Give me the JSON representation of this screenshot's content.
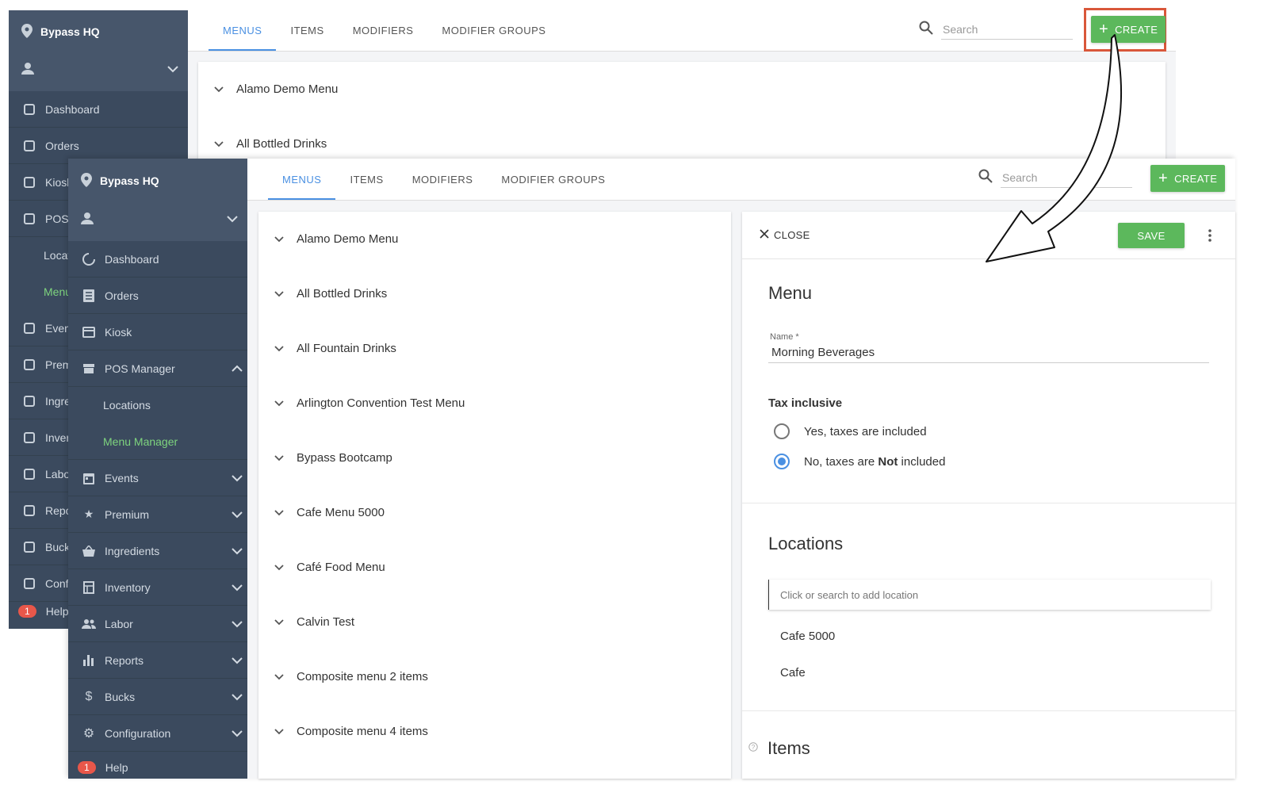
{
  "back": {
    "brand": "Bypass HQ",
    "tabs": [
      "MENUS",
      "ITEMS",
      "MODIFIERS",
      "MODIFIER GROUPS"
    ],
    "search_placeholder": "Search",
    "create_label": "CREATE",
    "menus": [
      "Alamo Demo Menu",
      "All Bottled Drinks"
    ],
    "sidebar": [
      {
        "label": "Dashboard",
        "icon": "dashboard-icon"
      },
      {
        "label": "Orders",
        "icon": "orders-icon"
      },
      {
        "label": "Kiosk",
        "icon": "kiosk-icon"
      },
      {
        "label": "POS M",
        "icon": "store-icon"
      },
      {
        "label": "Locat",
        "icon": ""
      },
      {
        "label": "Menu",
        "icon": ""
      },
      {
        "label": "Event",
        "icon": "calendar-icon"
      },
      {
        "label": "Premi",
        "icon": "star-icon"
      },
      {
        "label": "Ingre",
        "icon": "basket-icon"
      },
      {
        "label": "Inven",
        "icon": "inventory-icon"
      },
      {
        "label": "Labor",
        "icon": "people-icon"
      },
      {
        "label": "Repor",
        "icon": "bar-chart-icon"
      },
      {
        "label": "Bucks",
        "icon": "dollar-icon"
      },
      {
        "label": "Confi",
        "icon": "gear-icon"
      }
    ],
    "help": {
      "count": "1",
      "label": "Help"
    }
  },
  "front": {
    "brand": "Bypass HQ",
    "tabs": [
      "MENUS",
      "ITEMS",
      "MODIFIERS",
      "MODIFIER GROUPS"
    ],
    "search_placeholder": "Search",
    "create_label": "CREATE",
    "sidebar": {
      "dashboard": "Dashboard",
      "orders": "Orders",
      "kiosk": "Kiosk",
      "pos_manager": "POS Manager",
      "locations": "Locations",
      "menu_manager": "Menu Manager",
      "events": "Events",
      "premium": "Premium",
      "ingredients": "Ingredients",
      "inventory": "Inventory",
      "labor": "Labor",
      "reports": "Reports",
      "bucks": "Bucks",
      "configuration": "Configuration",
      "help": "Help",
      "help_count": "1"
    },
    "menus": [
      "Alamo Demo Menu",
      "All Bottled Drinks",
      "All Fountain Drinks",
      "Arlington Convention Test Menu",
      "Bypass Bootcamp",
      "Cafe Menu 5000",
      "Café Food Menu",
      "Calvin Test",
      "Composite menu 2 items",
      "Composite menu 4 items"
    ],
    "editor": {
      "close_label": "CLOSE",
      "save_label": "SAVE",
      "menu_heading": "Menu",
      "name_label": "Name *",
      "name_value": "Morning Beverages",
      "tax_heading": "Tax inclusive",
      "tax_yes": "Yes, taxes are included",
      "tax_no_prefix": "No, taxes are ",
      "tax_no_bold": "Not",
      "tax_no_suffix": " included",
      "locations_heading": "Locations",
      "location_placeholder": "Click or search to add location",
      "locations": [
        "Cafe 5000",
        "Cafe"
      ],
      "items_heading": "Items"
    }
  },
  "colors": {
    "accent": "#4a90e2",
    "create_green": "#5cb85c",
    "sidebar_bg": "#3b4a5e",
    "highlight_box": "#d9573a",
    "active_nav": "#7ed47e",
    "badge": "#e8574a"
  }
}
